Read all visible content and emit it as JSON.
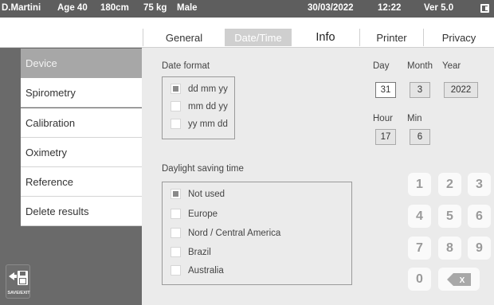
{
  "status": {
    "patient": "D.Martini",
    "age": "Age 40",
    "height": "180cm",
    "weight": "75 kg",
    "sex": "Male",
    "date": "30/03/2022",
    "time": "12:22",
    "version": "Ver 5.0"
  },
  "tabs": [
    {
      "label": "General"
    },
    {
      "label": "Date/Time"
    },
    {
      "label": "Info"
    },
    {
      "label": "Printer"
    },
    {
      "label": "Privacy"
    }
  ],
  "sidebar": {
    "items": [
      {
        "label": "Device"
      },
      {
        "label": "Spirometry"
      },
      {
        "label": "Calibration"
      },
      {
        "label": "Oximetry"
      },
      {
        "label": "Reference"
      },
      {
        "label": "Delete results"
      }
    ],
    "save_exit_label": "SAVE/EXIT"
  },
  "date_format": {
    "title": "Date format",
    "options": [
      {
        "label": "dd mm yy",
        "checked": true
      },
      {
        "label": "mm dd yy",
        "checked": false
      },
      {
        "label": "yy mm dd",
        "checked": false
      }
    ]
  },
  "dst": {
    "title": "Daylight saving time",
    "options": [
      {
        "label": "Not used",
        "checked": true
      },
      {
        "label": "Europe",
        "checked": false
      },
      {
        "label": "Nord / Central America",
        "checked": false
      },
      {
        "label": "Brazil",
        "checked": false
      },
      {
        "label": "Australia",
        "checked": false
      }
    ]
  },
  "datetime": {
    "day_label": "Day",
    "day": "31",
    "month_label": "Month",
    "month": "3",
    "year_label": "Year",
    "year": "2022",
    "hour_label": "Hour",
    "hour": "17",
    "min_label": "Min",
    "min": "6"
  },
  "keypad": {
    "keys": [
      "1",
      "2",
      "3",
      "4",
      "5",
      "6",
      "7",
      "8",
      "9",
      "0"
    ],
    "backspace_glyph": "X"
  },
  "colors": {
    "status_bar": "#5e5e5e",
    "sidebar_bg": "#6a6a6a",
    "panel_bg": "#ebebeb",
    "active_tab": "#cfcfcf",
    "active_side_item": "#a7a7a7"
  },
  "icons": {
    "save_exit": "floppy-disk-arrow-icon",
    "battery": "battery-icon",
    "backspace": "backspace-icon"
  }
}
